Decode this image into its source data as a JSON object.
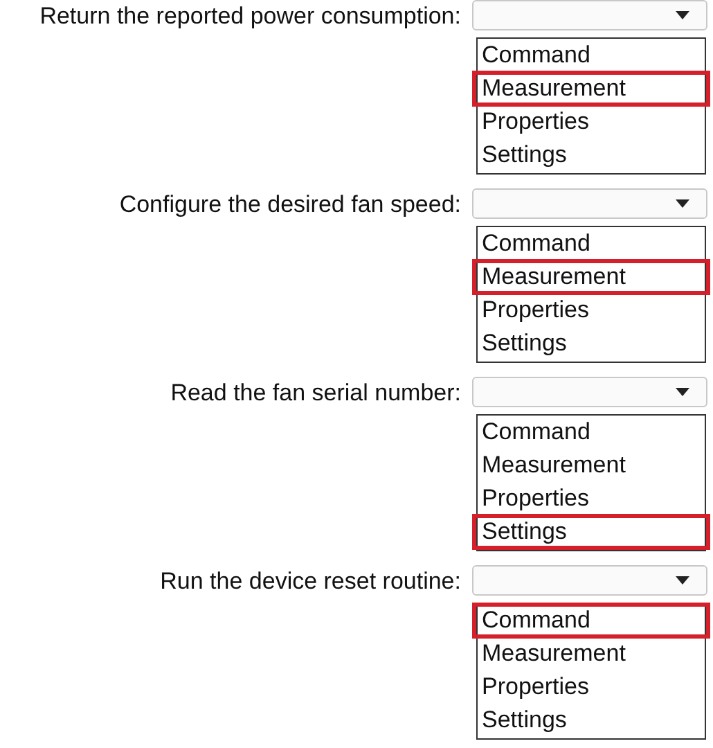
{
  "questions": [
    {
      "prompt": "Return the reported power consumption:",
      "options": [
        {
          "label": "Command",
          "selected": false
        },
        {
          "label": "Measurement",
          "selected": true
        },
        {
          "label": "Properties",
          "selected": false
        },
        {
          "label": "Settings",
          "selected": false
        }
      ]
    },
    {
      "prompt": "Configure the desired fan speed:",
      "options": [
        {
          "label": "Command",
          "selected": false
        },
        {
          "label": "Measurement",
          "selected": true
        },
        {
          "label": "Properties",
          "selected": false
        },
        {
          "label": "Settings",
          "selected": false
        }
      ]
    },
    {
      "prompt": "Read the fan serial number:",
      "options": [
        {
          "label": "Command",
          "selected": false
        },
        {
          "label": "Measurement",
          "selected": false
        },
        {
          "label": "Properties",
          "selected": false
        },
        {
          "label": "Settings",
          "selected": true
        }
      ]
    },
    {
      "prompt": "Run the device reset routine:",
      "options": [
        {
          "label": "Command",
          "selected": true
        },
        {
          "label": "Measurement",
          "selected": false
        },
        {
          "label": "Properties",
          "selected": false
        },
        {
          "label": "Settings",
          "selected": false
        }
      ]
    }
  ]
}
